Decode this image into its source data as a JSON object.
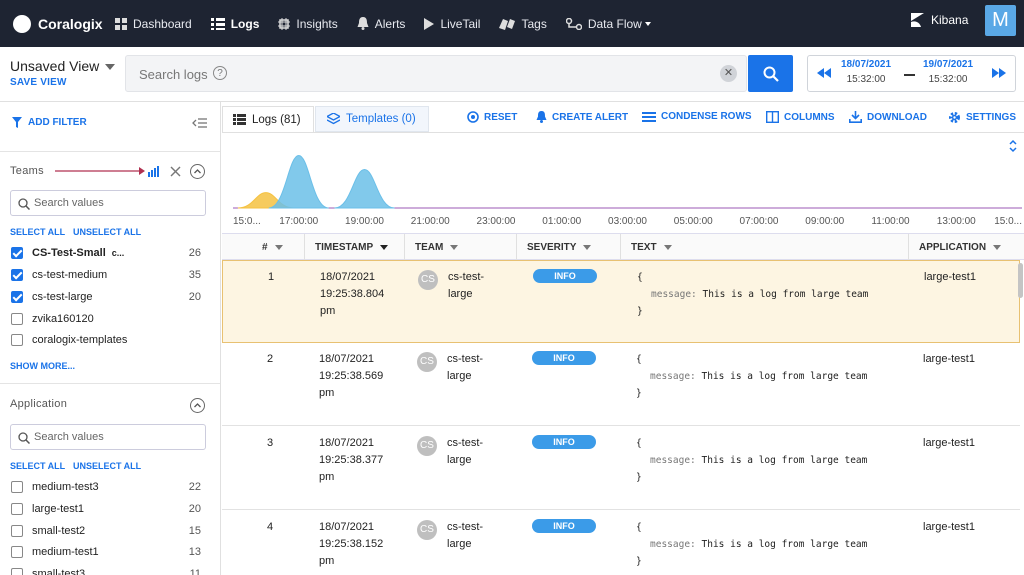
{
  "nav": {
    "brand": "Coralogix",
    "items": [
      {
        "label": "Dashboard",
        "icon": "dashboard-icon"
      },
      {
        "label": "Logs",
        "icon": "logs-icon"
      },
      {
        "label": "Insights",
        "icon": "insights-icon"
      },
      {
        "label": "Alerts",
        "icon": "bell-icon"
      },
      {
        "label": "LiveTail",
        "icon": "play-icon"
      },
      {
        "label": "Tags",
        "icon": "tags-icon"
      },
      {
        "label": "Data Flow",
        "icon": "data-flow-icon"
      }
    ],
    "kibana": "Kibana",
    "avatar": "M"
  },
  "view": {
    "name": "Unsaved View",
    "save": "SAVE VIEW"
  },
  "search": {
    "placeholder": "Search logs",
    "help": "?",
    "clear": "✕"
  },
  "daterange": {
    "from_date": "18/07/2021",
    "from_time": "15:32:00",
    "to_date": "19/07/2021",
    "to_time": "15:32:00"
  },
  "sidebar": {
    "add_filter": "ADD FILTER",
    "teams": {
      "title": "Teams",
      "search_placeholder": "Search values",
      "select_all": "SELECT ALL",
      "unselect_all": "UNSELECT ALL",
      "items": [
        {
          "label": "CS-Test-Small",
          "extra": "c...",
          "count": "26",
          "checked": true
        },
        {
          "label": "cs-test-medium",
          "count": "35",
          "checked": true
        },
        {
          "label": "cs-test-large",
          "count": "20",
          "checked": true
        },
        {
          "label": "zvika160120",
          "count": "",
          "checked": false
        },
        {
          "label": "coralogix-templates",
          "count": "",
          "checked": false
        }
      ],
      "show_more": "SHOW MORE..."
    },
    "application": {
      "title": "Application",
      "search_placeholder": "Search values",
      "select_all": "SELECT ALL",
      "unselect_all": "UNSELECT ALL",
      "items": [
        {
          "label": "medium-test3",
          "count": "22"
        },
        {
          "label": "large-test1",
          "count": "20"
        },
        {
          "label": "small-test2",
          "count": "15"
        },
        {
          "label": "medium-test1",
          "count": "13"
        },
        {
          "label": "small-test3",
          "count": "11"
        }
      ]
    }
  },
  "tabs": {
    "logs": "Logs (81)",
    "templates": "Templates (0)"
  },
  "toolbar": {
    "reset": "RESET",
    "create_alert": "CREATE ALERT",
    "condense": "CONDENSE ROWS",
    "columns": "COLUMNS",
    "download": "DOWNLOAD",
    "settings": "SETTINGS"
  },
  "chart_data": {
    "type": "area",
    "x_ticks": [
      "15:0...",
      "17:00:00",
      "19:00:00",
      "21:00:00",
      "23:00:00",
      "01:00:00",
      "03:00:00",
      "05:00:00",
      "07:00:00",
      "09:00:00",
      "11:00:00",
      "13:00:00",
      "15:0..."
    ],
    "series": [
      {
        "color": "#f5c242",
        "peaks": [
          {
            "x": "16:00",
            "height": 0.22
          }
        ]
      },
      {
        "color": "#6bbfe8",
        "peaks": [
          {
            "x": "17:00",
            "height": 0.75
          },
          {
            "x": "19:00",
            "height": 0.55
          }
        ]
      }
    ]
  },
  "table": {
    "columns": [
      "#",
      "TIMESTAMP",
      "TEAM",
      "SEVERITY",
      "TEXT",
      "APPLICATION"
    ],
    "rows": [
      {
        "n": "1",
        "date": "18/07/2021",
        "time": "19:25:38.804",
        "ampm": "pm",
        "avatar": "CS",
        "team1": "cs-test-",
        "team2": "large",
        "severity": "INFO",
        "open": "{",
        "key": "message:",
        "msg": "This is a log from large team",
        "close": "}",
        "app": "large-test1"
      },
      {
        "n": "2",
        "date": "18/07/2021",
        "time": "19:25:38.569",
        "ampm": "pm",
        "avatar": "CS",
        "team1": "cs-test-",
        "team2": "large",
        "severity": "INFO",
        "open": "{",
        "key": "message:",
        "msg": "This is a log from large team",
        "close": "}",
        "app": "large-test1"
      },
      {
        "n": "3",
        "date": "18/07/2021",
        "time": "19:25:38.377",
        "ampm": "pm",
        "avatar": "CS",
        "team1": "cs-test-",
        "team2": "large",
        "severity": "INFO",
        "open": "{",
        "key": "message:",
        "msg": "This is a log from large team",
        "close": "}",
        "app": "large-test1"
      },
      {
        "n": "4",
        "date": "18/07/2021",
        "time": "19:25:38.152",
        "ampm": "pm",
        "avatar": "CS",
        "team1": "cs-test-",
        "team2": "large",
        "severity": "INFO",
        "open": "{",
        "key": "message:",
        "msg": "This is a log from large team",
        "close": "}",
        "app": "large-test1"
      }
    ]
  }
}
